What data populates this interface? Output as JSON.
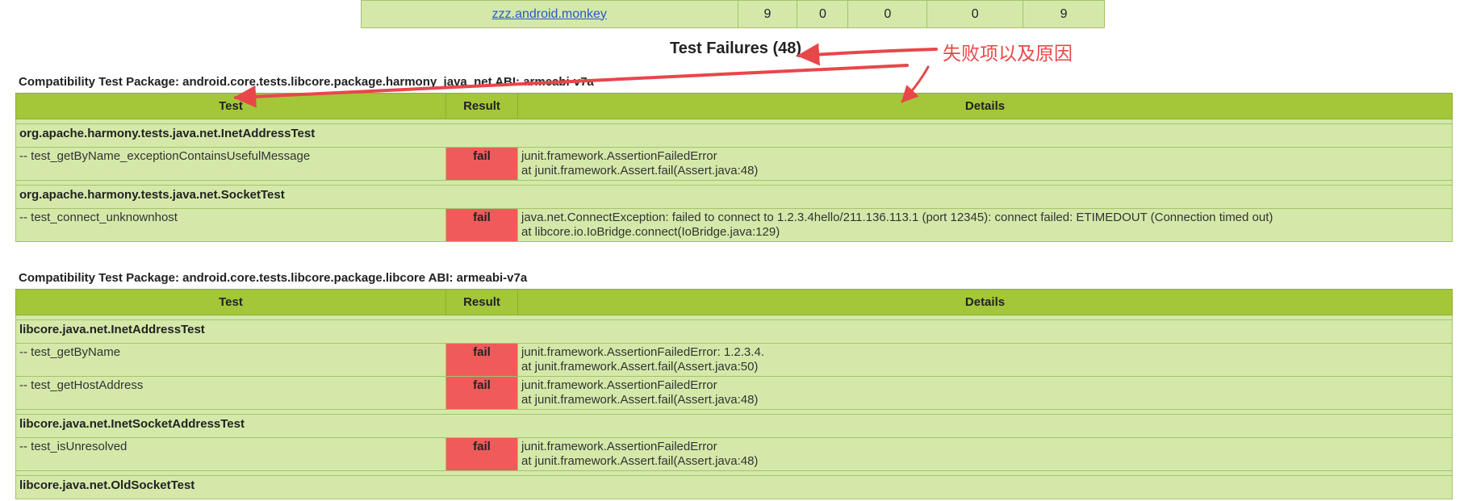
{
  "summary_row": {
    "package": "zzz.android.monkey",
    "values": [
      "9",
      "0",
      "0",
      "0",
      "9"
    ]
  },
  "failures_title": "Test Failures (48)",
  "annotation": "失败项以及原因",
  "columns": {
    "test": "Test",
    "result": "Result",
    "details": "Details"
  },
  "packages": [
    {
      "title": "Compatibility Test Package: android.core.tests.libcore.package.harmony_java_net ABI: armeabi-v7a",
      "groups": [
        {
          "class": "org.apache.harmony.tests.java.net.InetAddressTest",
          "tests": [
            {
              "name": "-- test_getByName_exceptionContainsUsefulMessage",
              "result": "fail",
              "detail1": "junit.framework.AssertionFailedError",
              "detail2": "at junit.framework.Assert.fail(Assert.java:48)"
            }
          ]
        },
        {
          "class": "org.apache.harmony.tests.java.net.SocketTest",
          "tests": [
            {
              "name": "-- test_connect_unknownhost",
              "result": "fail",
              "detail1": "java.net.ConnectException: failed to connect to 1.2.3.4hello/211.136.113.1 (port 12345): connect failed: ETIMEDOUT (Connection timed out)",
              "detail2": "at libcore.io.IoBridge.connect(IoBridge.java:129)"
            }
          ]
        }
      ]
    },
    {
      "title": "Compatibility Test Package: android.core.tests.libcore.package.libcore ABI: armeabi-v7a",
      "groups": [
        {
          "class": "libcore.java.net.InetAddressTest",
          "tests": [
            {
              "name": "-- test_getByName",
              "result": "fail",
              "detail1": "junit.framework.AssertionFailedError: 1.2.3.4.",
              "detail2": "at junit.framework.Assert.fail(Assert.java:50)"
            },
            {
              "name": "-- test_getHostAddress",
              "result": "fail",
              "detail1": "junit.framework.AssertionFailedError",
              "detail2": "at junit.framework.Assert.fail(Assert.java:48)"
            }
          ]
        },
        {
          "class": "libcore.java.net.InetSocketAddressTest",
          "tests": [
            {
              "name": "-- test_isUnresolved",
              "result": "fail",
              "detail1": "junit.framework.AssertionFailedError",
              "detail2": "at junit.framework.Assert.fail(Assert.java:48)"
            }
          ]
        },
        {
          "class": "libcore.java.net.OldSocketTest",
          "tests": []
        }
      ]
    }
  ]
}
